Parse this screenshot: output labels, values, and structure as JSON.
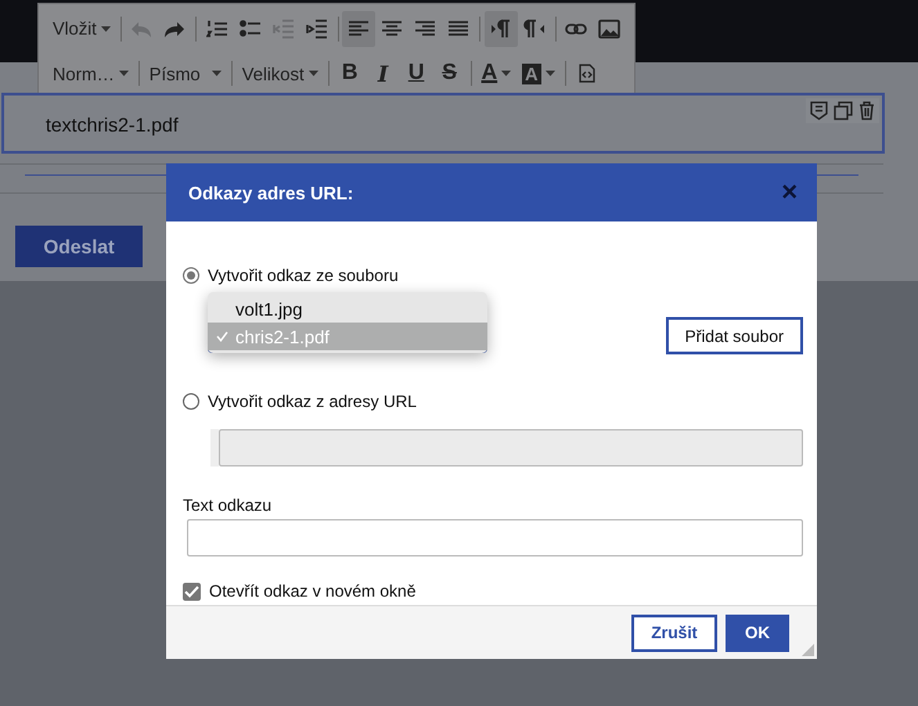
{
  "toolbar": {
    "rows": [
      [
        [
          {
            "kind": "menu",
            "label": "Vložit",
            "selected": false,
            "disabled": false
          }
        ],
        [
          {
            "kind": "undo",
            "selected": false,
            "disabled": true
          },
          {
            "kind": "redo",
            "selected": false,
            "disabled": false
          }
        ],
        [
          {
            "kind": "ordered-list",
            "selected": false,
            "disabled": false
          },
          {
            "kind": "bullet-list",
            "selected": false,
            "disabled": false
          },
          {
            "kind": "outdent",
            "selected": false,
            "disabled": true
          },
          {
            "kind": "indent",
            "selected": false,
            "disabled": false
          }
        ],
        [
          {
            "kind": "align-left",
            "selected": true,
            "disabled": false
          },
          {
            "kind": "align-center",
            "selected": false,
            "disabled": false
          },
          {
            "kind": "align-right",
            "selected": false,
            "disabled": false
          },
          {
            "kind": "justify",
            "selected": false,
            "disabled": false
          }
        ],
        [
          {
            "kind": "ltr",
            "selected": true,
            "disabled": false
          },
          {
            "kind": "rtl",
            "selected": false,
            "disabled": false
          }
        ],
        [
          {
            "kind": "link",
            "selected": false,
            "disabled": false
          },
          {
            "kind": "image",
            "selected": false,
            "disabled": false
          }
        ]
      ],
      [
        [
          {
            "kind": "select",
            "label": "Norm…",
            "selected": false,
            "disabled": false
          }
        ],
        [
          {
            "kind": "select",
            "label": "Písmo",
            "selected": false,
            "disabled": false
          }
        ],
        [
          {
            "kind": "select",
            "label": "Velikost",
            "selected": false,
            "disabled": false
          }
        ],
        [
          {
            "kind": "bold",
            "label": "B",
            "selected": false,
            "disabled": false
          },
          {
            "kind": "italic",
            "label": "I",
            "selected": false,
            "disabled": false
          },
          {
            "kind": "underline",
            "label": "U",
            "selected": false,
            "disabled": false
          },
          {
            "kind": "strike",
            "label": "S",
            "selected": false,
            "disabled": false
          }
        ],
        [
          {
            "kind": "text-color",
            "label": "A",
            "selected": false,
            "disabled": false
          },
          {
            "kind": "bg-color",
            "label": "A",
            "selected": false,
            "disabled": false
          }
        ],
        [
          {
            "kind": "source",
            "selected": false,
            "disabled": false
          }
        ]
      ]
    ]
  },
  "editor": {
    "text": "textchris2-1.pdf"
  },
  "submit_button": "Odeslat",
  "dialog": {
    "title": "Odkazy adres URL:",
    "close": "×",
    "file_option": {
      "label": "Vytvořit odkaz ze souboru",
      "selected": true
    },
    "file_menu": [
      {
        "label": "volt1.jpg",
        "selected": false
      },
      {
        "label": "chris2-1.pdf",
        "selected": true
      }
    ],
    "add_file_button": "Přidat soubor",
    "url_option": {
      "label": "Vytvořit odkaz z adresy URL",
      "selected": false
    },
    "url_field": {
      "disabled": true
    },
    "link_text": {
      "label": "Text odkazu"
    },
    "new_window": {
      "label": "Otevřít odkaz v novém okně",
      "checked": true
    },
    "buttons": [
      "Zrušit",
      "OK"
    ]
  }
}
